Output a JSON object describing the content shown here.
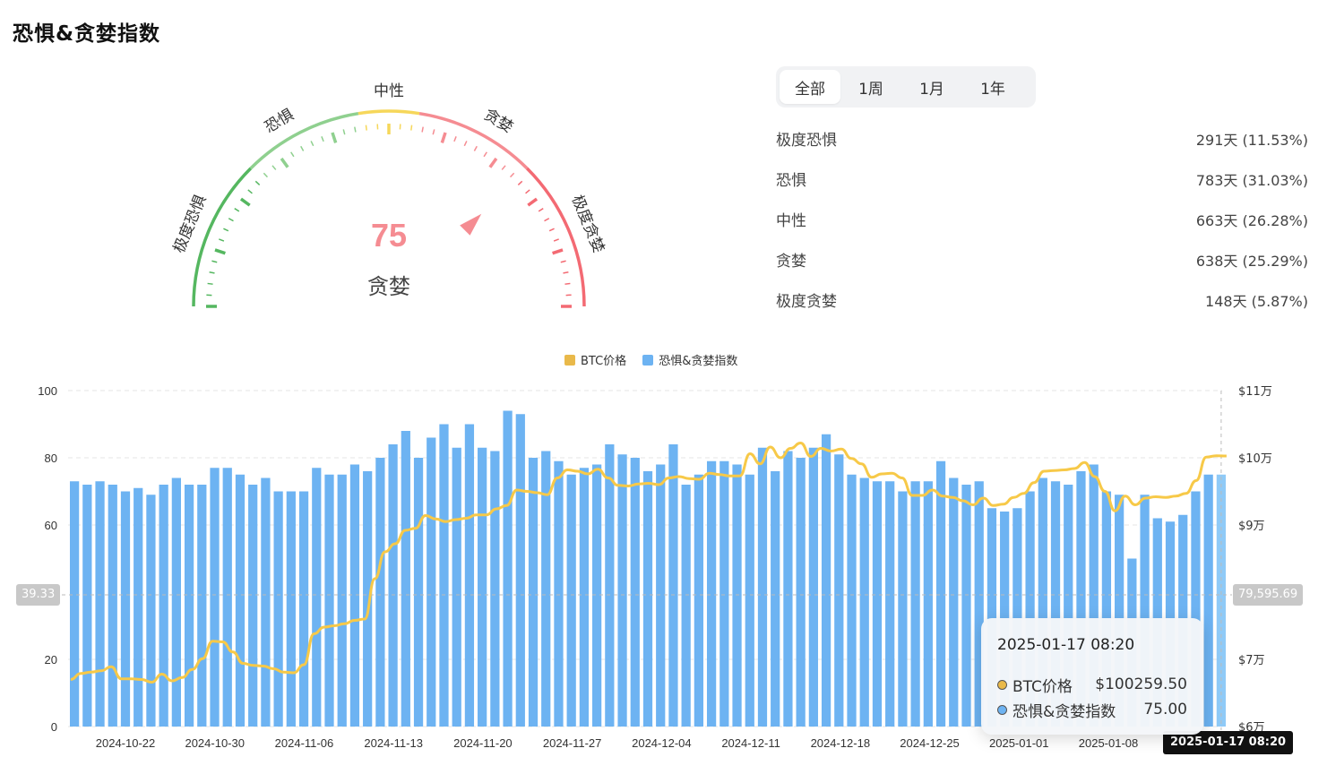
{
  "page_title": "恐惧&贪婪指数",
  "gauge": {
    "value": "75",
    "label": "贪婪",
    "value_fraction": 0.75,
    "zones": [
      {
        "label": "极度恐惧",
        "color": "#55b760"
      },
      {
        "label": "恐惧",
        "color": "#8fd08f"
      },
      {
        "label": "中性",
        "color": "#f6d75a"
      },
      {
        "label": "贪婪",
        "color": "#f58c92"
      },
      {
        "label": "极度贪婪",
        "color": "#f36a73"
      }
    ]
  },
  "tabs": [
    {
      "label": "全部",
      "active": true
    },
    {
      "label": "1周",
      "active": false
    },
    {
      "label": "1月",
      "active": false
    },
    {
      "label": "1年",
      "active": false
    }
  ],
  "stats": [
    {
      "label": "极度恐惧",
      "value": "291天 (11.53%)"
    },
    {
      "label": "恐惧",
      "value": "783天 (31.03%)"
    },
    {
      "label": "中性",
      "value": "663天 (26.28%)"
    },
    {
      "label": "贪婪",
      "value": "638天 (25.29%)"
    },
    {
      "label": "极度贪婪",
      "value": "148天 (5.87%)"
    }
  ],
  "legend": [
    {
      "label": "BTC价格",
      "color": "#e9b94a"
    },
    {
      "label": "恐惧&贪婪指数",
      "color": "#6db3f2"
    }
  ],
  "tooltip": {
    "date": "2025-01-17 08:20",
    "rows": [
      {
        "label": "BTC价格",
        "value": "$100259.50",
        "color": "#e9b94a"
      },
      {
        "label": "恐惧&贪婪指数",
        "value": "75.00",
        "color": "#6db3f2"
      }
    ]
  },
  "crosshair": {
    "left_value": "39.33",
    "right_value": "79,595.69",
    "date": "2025-01-17 08:20"
  },
  "colors": {
    "bar": "#6db3f2",
    "bar_highlight": "#8fcaf7",
    "line": "#f7c948",
    "grid": "#e6e6e6"
  },
  "chart_data": {
    "type": "bar",
    "left_axis": {
      "ticks": [
        "100",
        "80",
        "60",
        "20",
        "0"
      ],
      "tick_values": [
        100,
        80,
        60,
        20,
        0
      ],
      "ylim": [
        0,
        100
      ]
    },
    "right_axis": {
      "ticks": [
        "$11万",
        "$10万",
        "$9万",
        "$7万",
        "$6万"
      ],
      "tick_values": [
        110000,
        100000,
        90000,
        70000,
        60000
      ],
      "ylim": [
        60000,
        110000
      ]
    },
    "x_tick_labels": [
      "2024-10-22",
      "2024-10-30",
      "2024-11-06",
      "2024-11-13",
      "2024-11-20",
      "2024-11-27",
      "2024-12-04",
      "2024-12-11",
      "2024-12-18",
      "2024-12-25",
      "2025-01-01",
      "2025-01-08"
    ],
    "series": [
      {
        "name": "恐惧&贪婪指数",
        "type": "bar",
        "axis": "left",
        "values": [
          73,
          72,
          73,
          72,
          70,
          71,
          69,
          72,
          74,
          72,
          72,
          77,
          77,
          75,
          72,
          74,
          70,
          70,
          70,
          77,
          75,
          75,
          78,
          76,
          80,
          84,
          88,
          80,
          86,
          90,
          83,
          90,
          83,
          82,
          94,
          93,
          80,
          82,
          79,
          75,
          77,
          78,
          84,
          81,
          80,
          76,
          78,
          84,
          72,
          75,
          79,
          79,
          78,
          75,
          83,
          76,
          82,
          80,
          83,
          87,
          81,
          75,
          74,
          73,
          73,
          70,
          73,
          73,
          79,
          74,
          72,
          73,
          65,
          64,
          65,
          70,
          74,
          73,
          72,
          76,
          78,
          70,
          69,
          50,
          69,
          62,
          61,
          63,
          70,
          75,
          75
        ]
      },
      {
        "name": "BTC价格",
        "type": "line",
        "axis": "right",
        "values": [
          67000,
          67900,
          68100,
          68300,
          68900,
          67100,
          67100,
          67000,
          66600,
          67800,
          66800,
          67300,
          68500,
          70100,
          72700,
          72600,
          71100,
          69400,
          69100,
          69000,
          68600,
          68100,
          68000,
          69200,
          73800,
          74800,
          75000,
          75300,
          75800,
          76000,
          82000,
          86000,
          87200,
          89200,
          89500,
          91400,
          90900,
          90500,
          90800,
          91000,
          91500,
          91500,
          92400,
          92900,
          95200,
          95000,
          94800,
          94500,
          97000,
          98200,
          98000,
          97600,
          98300,
          97000,
          95900,
          95800,
          96100,
          96200,
          96000,
          97000,
          97200,
          96900,
          96800,
          97700,
          97500,
          97300,
          97300,
          100600,
          99100,
          101600,
          100000,
          101400,
          102200,
          100200,
          101400,
          101000,
          101300,
          99900,
          99100,
          97100,
          97600,
          97700,
          97000,
          94400,
          94400,
          95200,
          94300,
          94100,
          93600,
          93000,
          94000,
          92900,
          93100,
          94100,
          94700,
          96300,
          98000,
          98100,
          98200,
          98400,
          99300,
          97200,
          95000,
          92100,
          94300,
          93000,
          94000,
          94200,
          94100,
          94300,
          94700,
          96600,
          100100,
          100300,
          100259.5
        ]
      }
    ],
    "grid": true,
    "legend_position": "top-center"
  }
}
